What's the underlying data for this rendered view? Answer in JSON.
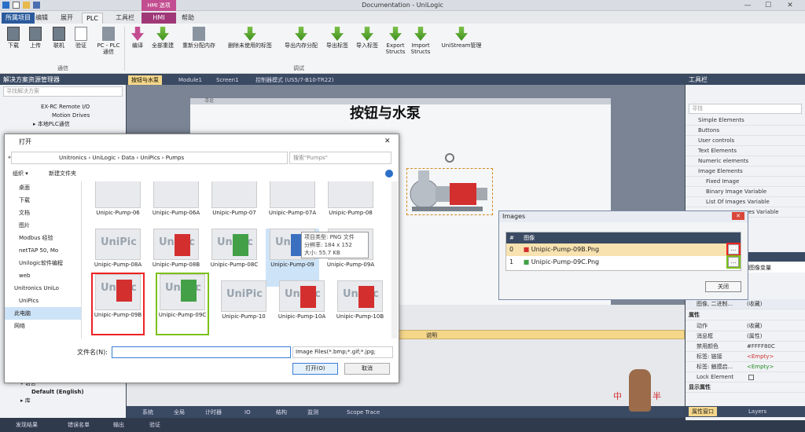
{
  "window": {
    "title": "Documentation - UniLogic",
    "controls": [
      "—",
      "☐",
      "✕"
    ]
  },
  "menu": {
    "context_tab": "HMI 选项",
    "tabs": [
      "所属项目",
      "编辑",
      "展开",
      "PLC",
      "工具栏",
      "HMI",
      "帮助"
    ]
  },
  "ribbon": {
    "buttons": [
      "下载",
      "上传",
      "联机",
      "验证",
      "PC - PLC通信",
      "编译",
      "全部重建",
      "重新分配内存",
      "删除未使用的标签",
      "导出内存分配",
      "导出标签",
      "导入标签",
      "Export Structs",
      "Import Structs",
      "UniStream管理"
    ],
    "groups": [
      "通信",
      "调试"
    ]
  },
  "left_panel": {
    "title": "解决方案资源管理器",
    "search_placeholder": "寻找解决方案",
    "tree": [
      "EX-RC Remote I/O",
      "Motion Drives",
      "▸ 本地PLC通信"
    ],
    "tree_bottom": [
      "▾ 语言",
      "Default (English)",
      "▸ 库"
    ]
  },
  "doc_tabs": [
    "按钮与水泵",
    "Module1",
    "Screen1",
    "控制器模式 (US5/7-B10-TR22)"
  ],
  "screen": {
    "header": "寻论",
    "title": "按钮与水泵"
  },
  "open_dialog": {
    "title": "打开",
    "path": [
      "Unitronics",
      "UniLogic",
      "Data",
      "UniPics",
      "Pumps"
    ],
    "search_placeholder": "搜索\"Pumps\"",
    "toolbar": {
      "organize": "组织 ▾",
      "new_folder": "新建文件夹"
    },
    "nav": [
      "桌面",
      "下载",
      "文档",
      "图片",
      "Modbus 经验",
      "netTAP 50, Mo",
      "Unilogic软件编程",
      "web",
      "Unitronics UniLo",
      "UniPics",
      "此电脑",
      "网络"
    ],
    "files_row0": [
      "Unipic-Pump-06",
      "Unipic-Pump-06A",
      "Unipic-Pump-07",
      "Unipic-Pump-07A",
      "Unipic-Pump-08"
    ],
    "files_row1": [
      "Unipic-Pump-08A",
      "Unipic-Pump-08B",
      "Unipic-Pump-08C",
      "Unipic-Pump-09",
      "Unipic-Pump-09A"
    ],
    "files_row2": [
      "Unipic-Pump-09B",
      "Unipic-Pump-09C",
      "Unipic-Pump-10",
      "Unipic-Pump-10A",
      "Unipic-Pump-10B"
    ],
    "tooltip": [
      "项目类型: PNG 文件",
      "分辨率: 184 x 152",
      "大小: 55.7 KB"
    ],
    "filename_label": "文件名(N):",
    "filename_value": "",
    "filetype": "Image Files(*.bmp;*.gif;*.jpg;",
    "open_button": "打开(O)",
    "cancel_button": "取消"
  },
  "images_dialog": {
    "title": "Images",
    "col_num": "#",
    "col_image": "图像",
    "rows": [
      {
        "idx": "0",
        "name": "Unipic-Pump-09B.Png"
      },
      {
        "idx": "1",
        "name": "Unipic-Pump-09C.Png"
      }
    ],
    "ellipsis": "...",
    "close_button": "关闭"
  },
  "right_panel": {
    "title": "工具栏",
    "search_placeholder": "寻找",
    "items": [
      "Simple Elements",
      "Buttons",
      "User controls",
      "Text Elements",
      "Numeric elements",
      "Image Elements",
      "Fixed Image",
      "Binary Image Variable",
      "List Of Images Variable",
      "es Variable"
    ],
    "props_header": "二进制图像变量",
    "props_sub": "图像, 二进制...",
    "props_sub_val": "(收藏)",
    "props_section": "属性",
    "props": [
      {
        "k": "动作",
        "v": "(收藏)"
      },
      {
        "k": "消息框",
        "v": "(属性)"
      },
      {
        "k": "禁用颜色",
        "v": "#FFFF80C"
      },
      {
        "k": "标签: 链接",
        "v": "<Empty>"
      },
      {
        "k": "标签: 触摸启...",
        "v": "<Empty>"
      },
      {
        "k": "Lock Element",
        "v": ""
      },
      {
        "k": "显示属性",
        "v": ""
      }
    ],
    "bottom_tabs": [
      "属性窗口",
      "Layers"
    ]
  },
  "bottom_panel": {
    "col": "说明",
    "tabs": [
      "系统",
      "全局",
      "计时器",
      "IO",
      "结构",
      "监测",
      "Scope Trace"
    ]
  },
  "status_tabs": [
    "发现结果",
    "错误名单",
    "输出",
    "验证"
  ],
  "watermark": {
    "text1": "中",
    "text2": "半"
  }
}
